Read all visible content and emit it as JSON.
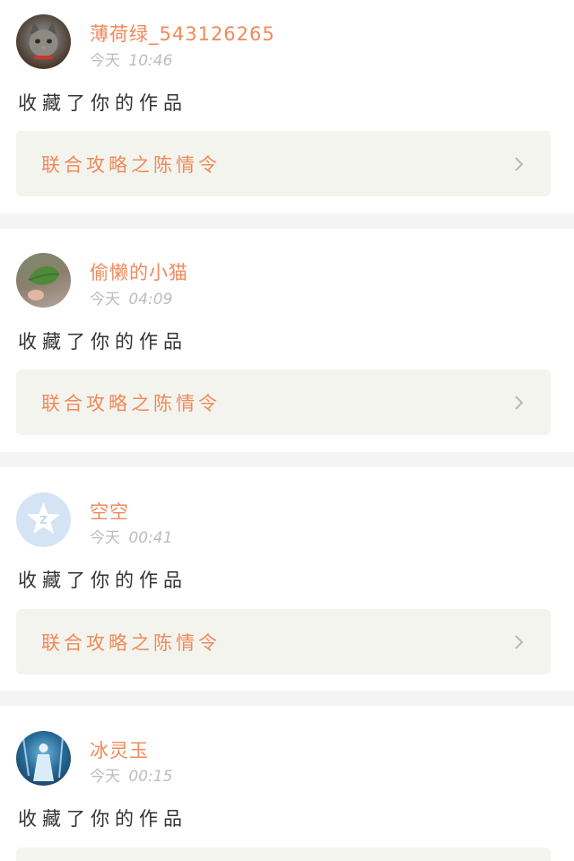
{
  "colors": {
    "accent": "#ef8a5c",
    "page_bg": "#f4f4f4",
    "link_bg": "#f4f4ee",
    "action_text": "#333333",
    "time_text": "#bdbdbd"
  },
  "notifications": [
    {
      "user_name": "薄荷绿_543126265",
      "time_prefix": "今天",
      "time": "10:46",
      "action": "收藏了你的作品",
      "work_title": "联合攻略之陈情令",
      "avatar_icon": "cat-photo-avatar",
      "chevron_icon": "chevron-right-icon"
    },
    {
      "user_name": "偷懒的小猫",
      "time_prefix": "今天",
      "time": "04:09",
      "action": "收藏了你的作品",
      "work_title": "联合攻略之陈情令",
      "avatar_icon": "leaf-photo-avatar",
      "chevron_icon": "chevron-right-icon"
    },
    {
      "user_name": "空空",
      "time_prefix": "今天",
      "time": "00:41",
      "action": "收藏了你的作品",
      "work_title": "联合攻略之陈情令",
      "avatar_icon": "default-qzone-star-avatar",
      "chevron_icon": "chevron-right-icon"
    },
    {
      "user_name": "冰灵玉",
      "time_prefix": "今天",
      "time": "00:15",
      "action": "收藏了你的作品",
      "work_title": "",
      "avatar_icon": "figure-in-blue-photo-avatar",
      "chevron_icon": "chevron-right-icon"
    }
  ]
}
